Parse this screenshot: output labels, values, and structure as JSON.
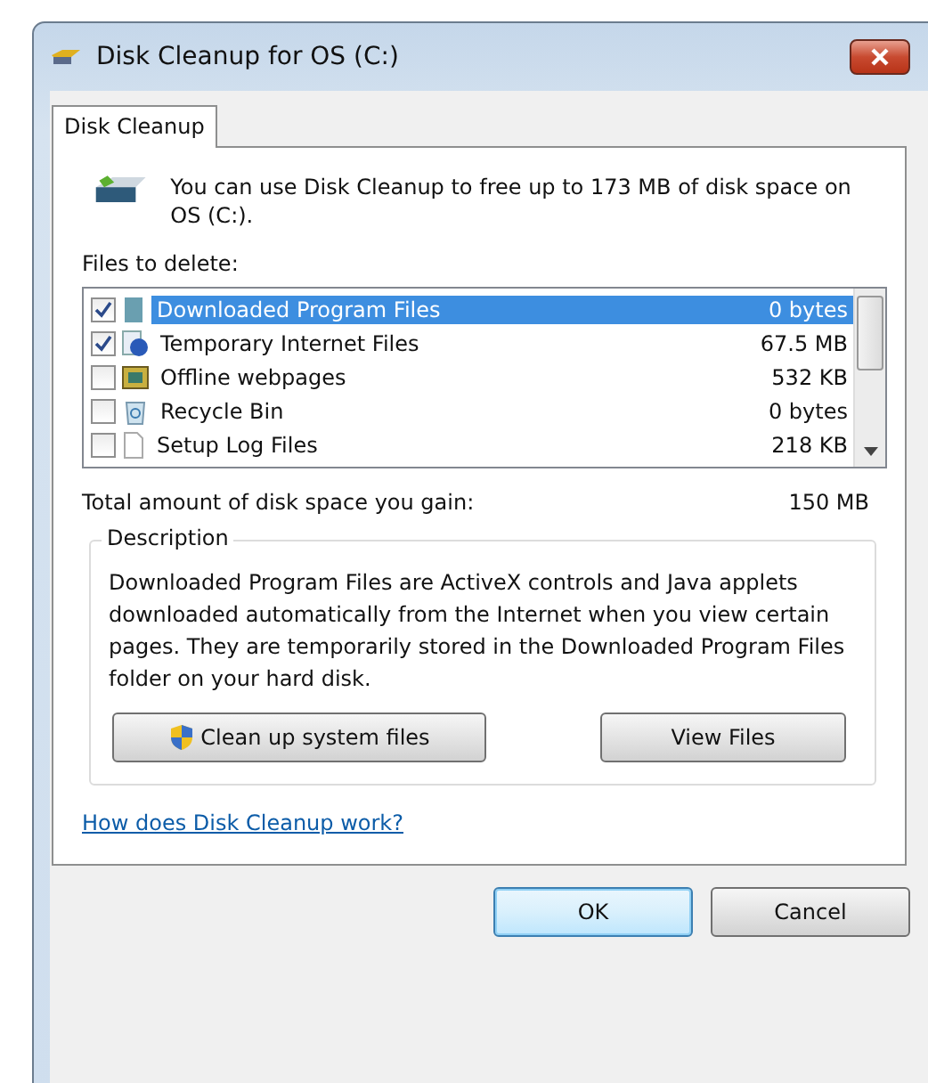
{
  "window": {
    "title": "Disk Cleanup for OS (C:)"
  },
  "tabs": [
    {
      "label": "Disk Cleanup",
      "selected": true
    }
  ],
  "intro": "You can use Disk Cleanup to free up to 173 MB of disk space on OS (C:).",
  "files_label": "Files to delete:",
  "files": [
    {
      "name": "Downloaded Program Files",
      "size": "0 bytes",
      "checked": true,
      "selected": true,
      "kind": "folder"
    },
    {
      "name": "Temporary Internet Files",
      "size": "67.5 MB",
      "checked": true,
      "selected": false,
      "kind": "internet"
    },
    {
      "name": "Offline webpages",
      "size": "532 KB",
      "checked": false,
      "selected": false,
      "kind": "offline"
    },
    {
      "name": "Recycle Bin",
      "size": "0 bytes",
      "checked": false,
      "selected": false,
      "kind": "bin"
    },
    {
      "name": "Setup Log Files",
      "size": "218 KB",
      "checked": false,
      "selected": false,
      "kind": "file"
    }
  ],
  "total": {
    "label": "Total amount of disk space you gain:",
    "value": "150 MB"
  },
  "description": {
    "title": "Description",
    "text": "Downloaded Program Files are ActiveX controls and Java applets downloaded automatically from the Internet when you view certain pages. They are temporarily stored in the Downloaded Program Files folder on your hard disk."
  },
  "actions": [
    {
      "label": "Clean up system files",
      "kind": "shield"
    },
    {
      "label": "View Files",
      "kind": "plain"
    }
  ],
  "help_link": "How does Disk Cleanup work?",
  "buttons": [
    {
      "label": "OK",
      "kind": "default"
    },
    {
      "label": "Cancel",
      "kind": "normal"
    }
  ]
}
